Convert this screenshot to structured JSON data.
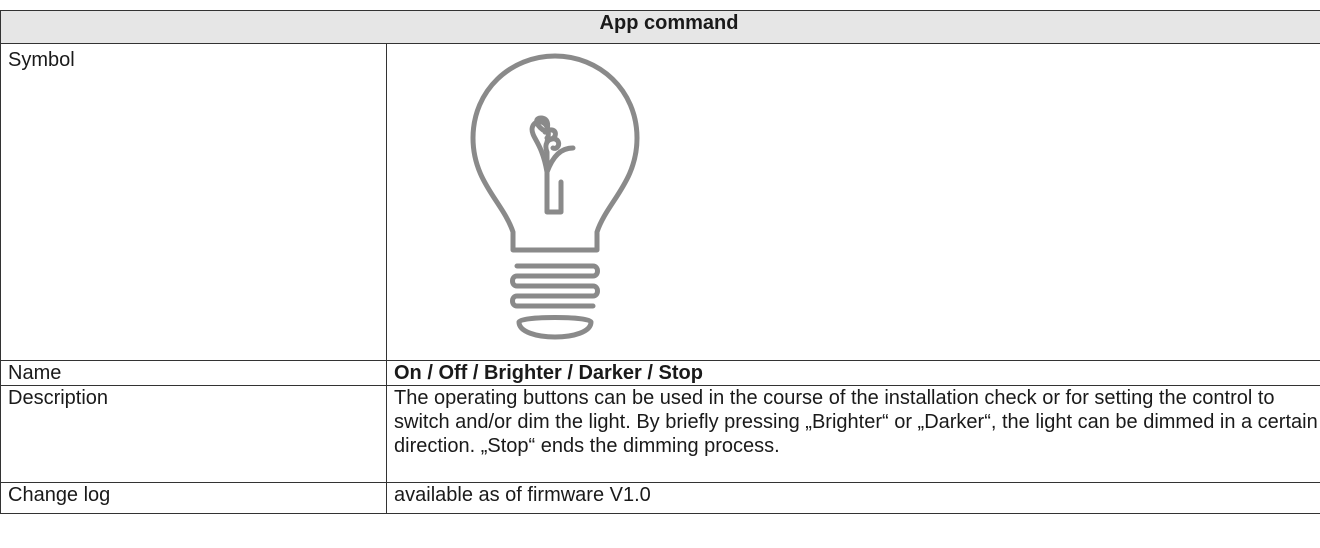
{
  "table": {
    "header": "App command",
    "rows": {
      "symbol": {
        "label": "Symbol",
        "icon": "light-bulb-icon"
      },
      "name": {
        "label": "Name",
        "value": "On / Off / Brighter / Darker / Stop"
      },
      "description": {
        "label": "Description",
        "value": "The operating buttons can be used in the course of the installation check or for setting the control to switch and/or dim the light. By briefly pressing „Brighter“ or „Darker“, the light can be dimmed in a certain direction. „Stop“ ends the dimming process."
      },
      "changelog": {
        "label": "Change log",
        "value": "available as of firmware V1.0"
      }
    }
  },
  "colors": {
    "border": "#333333",
    "header_bg": "#e6e6e6",
    "icon_stroke": "#8a8a8a"
  }
}
